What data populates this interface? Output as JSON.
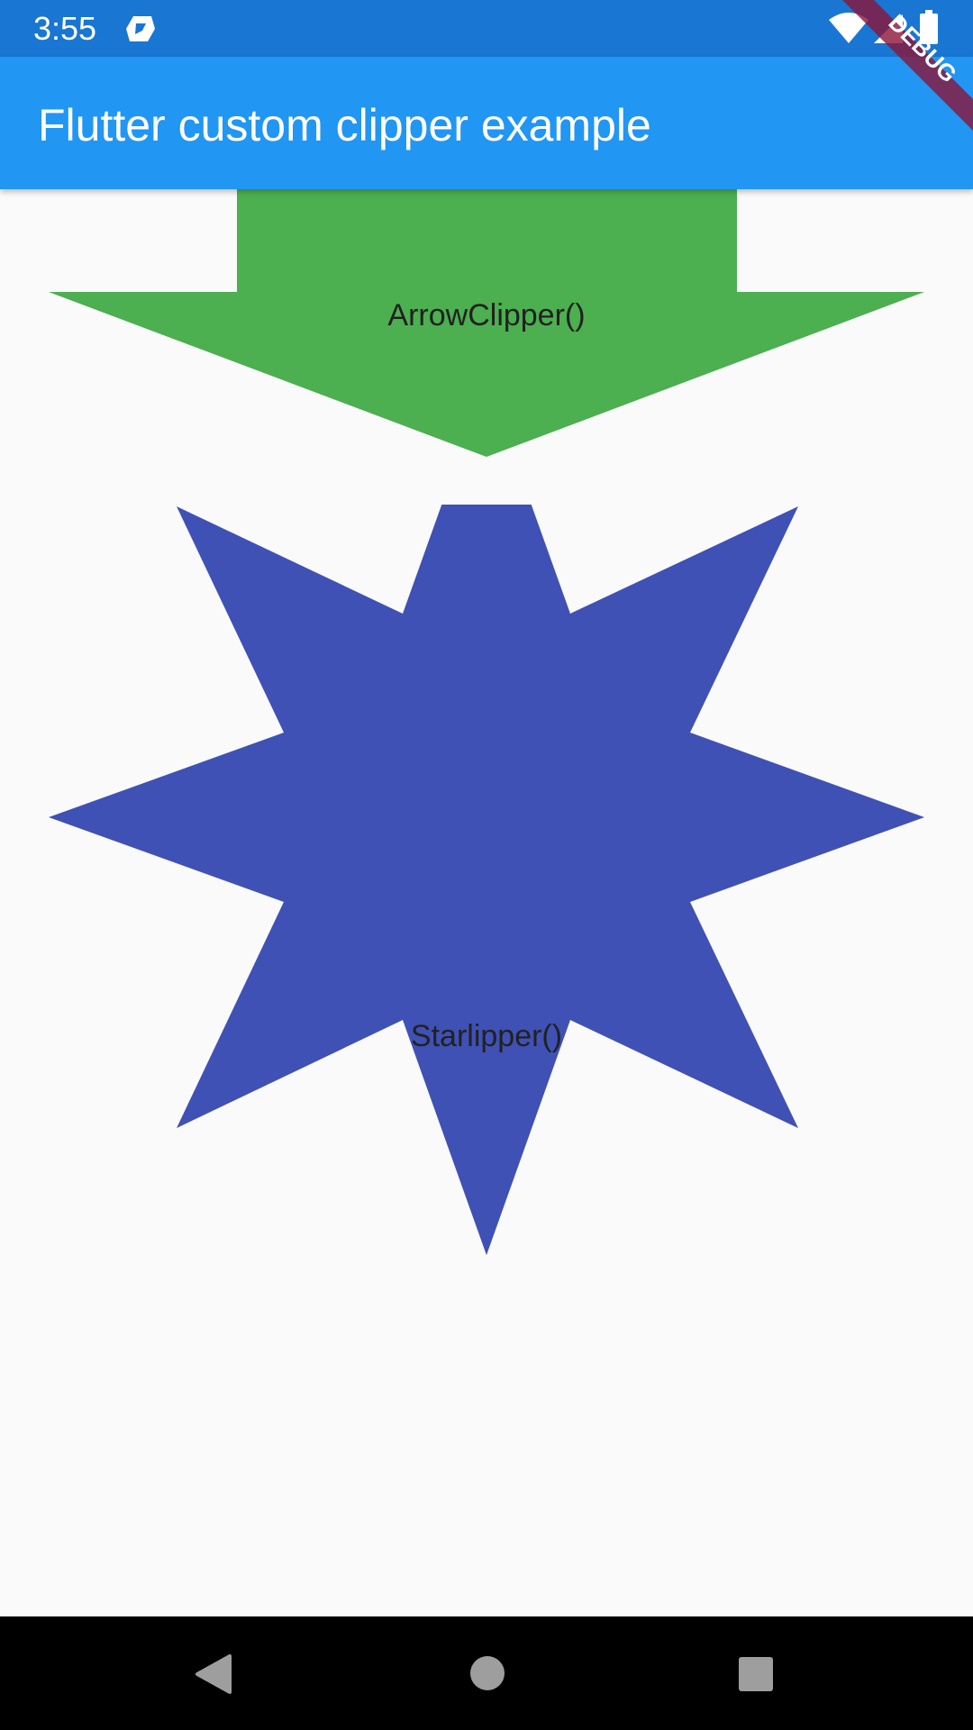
{
  "status_bar": {
    "time": "3:55",
    "icons": [
      "app-notification-icon",
      "wifi-icon",
      "signal-icon",
      "battery-icon"
    ],
    "background": "#1976d2"
  },
  "app_bar": {
    "title": "Flutter custom clipper example",
    "background": "#2196f3"
  },
  "debug_banner": {
    "label": "DEBUG",
    "color": "#8b1538"
  },
  "arrow_clipper": {
    "label": "ArrowClipper()",
    "color": "#4caf50"
  },
  "star_clipper": {
    "label": "Starlipper()",
    "color": "#3f51b5"
  },
  "nav_bar": {
    "icons": [
      "back-icon",
      "home-icon",
      "recents-icon"
    ],
    "background": "#000000"
  }
}
